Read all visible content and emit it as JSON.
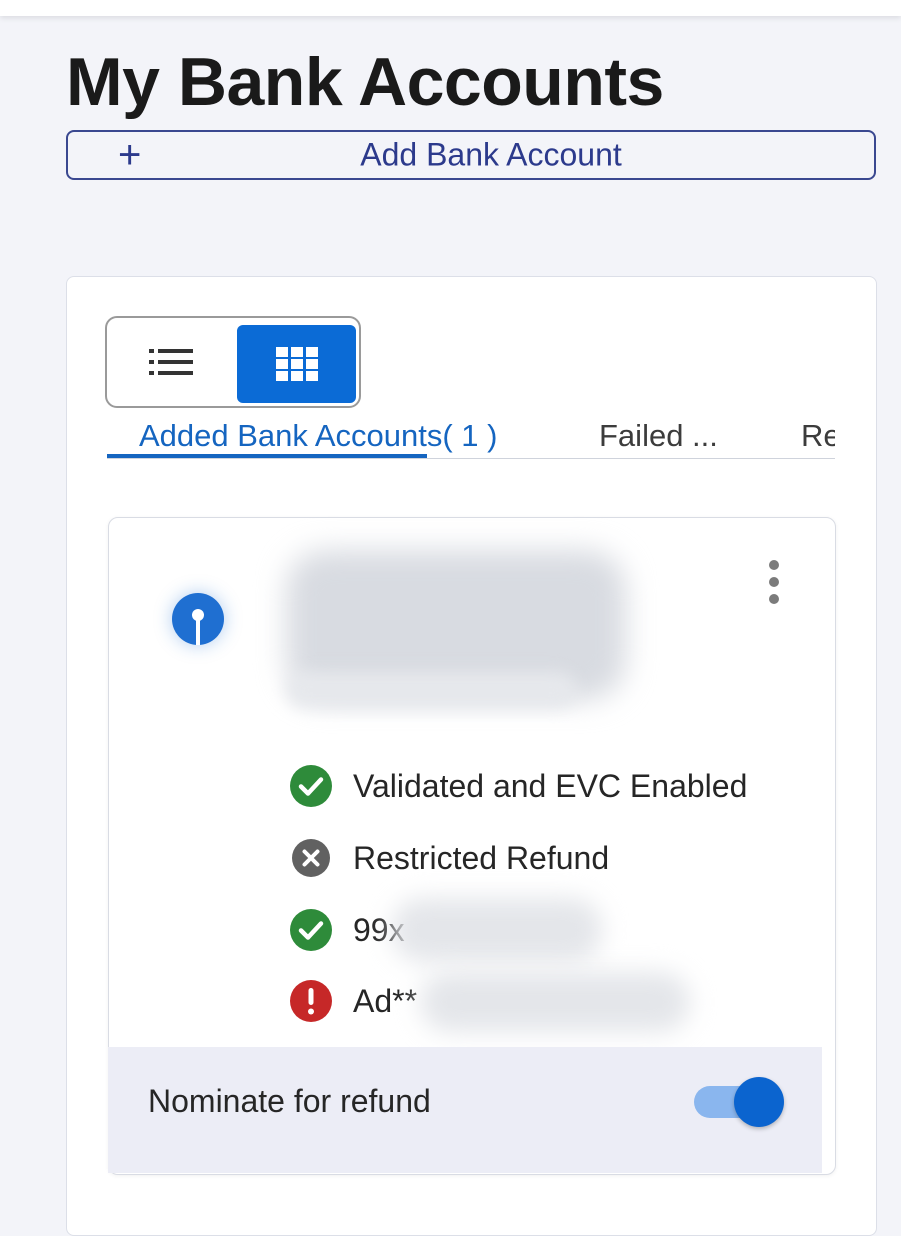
{
  "header": {
    "title": "My Bank Accounts",
    "add_button_icon": "plus-icon",
    "add_button_label": "Add Bank Account"
  },
  "view_toggle": {
    "options": [
      "list-view",
      "grid-view"
    ],
    "selected": "grid-view"
  },
  "tabs": [
    {
      "label": "Added Bank Accounts( 1 )",
      "active": true
    },
    {
      "label": "Failed ...",
      "active": false
    },
    {
      "label": "Re",
      "active": false
    }
  ],
  "account_card": {
    "bank_logo_icon": "sbi-bank-logo-icon",
    "menu_icon": "more-vertical-icon",
    "statuses": [
      {
        "icon": "check-circle-icon",
        "text": "Validated and EVC Enabled",
        "color": "#2e8b3a"
      },
      {
        "icon": "cancel-circle-icon",
        "text": "Restricted Refund",
        "color": "#616161"
      },
      {
        "icon": "check-circle-icon",
        "text": "99x",
        "color": "#2e8b3a"
      },
      {
        "icon": "error-circle-icon",
        "text": "Ad**",
        "color": "#c62828"
      }
    ],
    "refund": {
      "label": "Nominate for refund",
      "enabled": true
    }
  },
  "colors": {
    "accent": "#1565c0",
    "primary_button": "#0b6bd6",
    "success": "#2e8b3a",
    "error": "#c62828",
    "neutral": "#616161",
    "background": "#f3f4f9"
  }
}
